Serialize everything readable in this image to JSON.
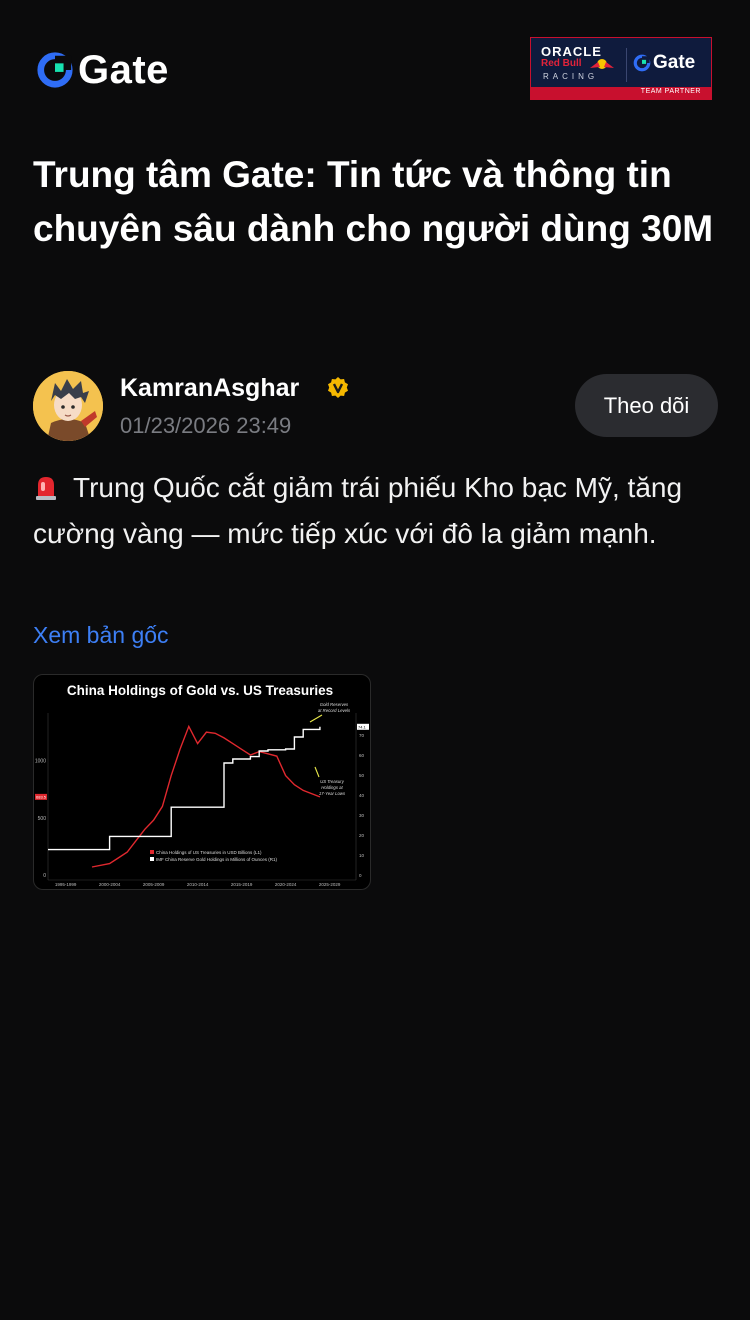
{
  "header": {
    "logo_text": "Gate",
    "partner": {
      "line1": "ORACLE",
      "line2": "Red Bull",
      "line3": "RACING",
      "brand": "Gate",
      "tag": "TEAM PARTNER"
    }
  },
  "page_title": "Trung tâm Gate: Tin tức và thông tin chuyên sâu dành cho người dùng 30M",
  "post": {
    "author": "KamranAsghar",
    "timestamp": "01/23/2026 23:49",
    "follow_label": "Theo dõi",
    "text": "Trung Quốc cắt giảm trái phiếu Kho bạc Mỹ, tăng cường vàng — mức tiếp xúc với đô la giảm mạnh.",
    "view_original_label": "Xem bản gốc"
  },
  "colors": {
    "background": "#0b0b0c",
    "accent_blue": "#3d7ff5",
    "verified_gold": "#f5b800",
    "series_red": "#e0282e",
    "series_white": "#ffffff"
  },
  "icons": {
    "logo": "gate-logo-icon",
    "verified": "verified-badge-icon",
    "siren": "siren-emoji-icon"
  },
  "chart_data": {
    "type": "line",
    "title": "China Holdings of Gold vs. US Treasuries",
    "x_tick_labels": [
      "1995-1999",
      "2000-2004",
      "2005-2009",
      "2010-2014",
      "2015-2019",
      "2020-2024",
      "2025-2029"
    ],
    "y_left_ticks": [
      0,
      500,
      1000
    ],
    "y_right_ticks": [
      0,
      10,
      20,
      30,
      40,
      50,
      60,
      70
    ],
    "y_left_marker": "683.5",
    "y_right_marker": "74.1",
    "annotations": [
      "Gold Reserves at Record Levels",
      "US Treasury Holdings at 17-Year Lows"
    ],
    "series": [
      {
        "name": "China Holdings of US Treasuries in USD Billions (L1)",
        "axis": "left",
        "x": [
          2000,
          2002,
          2003,
          2004,
          2005,
          2006,
          2007,
          2008,
          2009,
          2010,
          2011,
          2012,
          2013,
          2014,
          2015,
          2016,
          2017,
          2018,
          2019,
          2020,
          2021,
          2022,
          2023,
          2024,
          2025.9
        ],
        "y": [
          70,
          100,
          150,
          200,
          300,
          400,
          480,
          600,
          870,
          1100,
          1300,
          1150,
          1250,
          1240,
          1200,
          1150,
          1100,
          1050,
          1080,
          1060,
          1040,
          870,
          790,
          740,
          683.5
        ]
      },
      {
        "name": "IMF China Reserve Gold Holdings in Millions of Ounces (R1)",
        "axis": "right",
        "x": [
          1995,
          2001,
          2002,
          2009,
          2015,
          2016,
          2018,
          2019,
          2020,
          2022,
          2023,
          2024,
          2025.9
        ],
        "y": [
          12.7,
          12.7,
          19.3,
          33.9,
          56,
          58,
          59.2,
          62,
          62.6,
          63,
          69,
          72.8,
          74.1
        ]
      }
    ]
  }
}
